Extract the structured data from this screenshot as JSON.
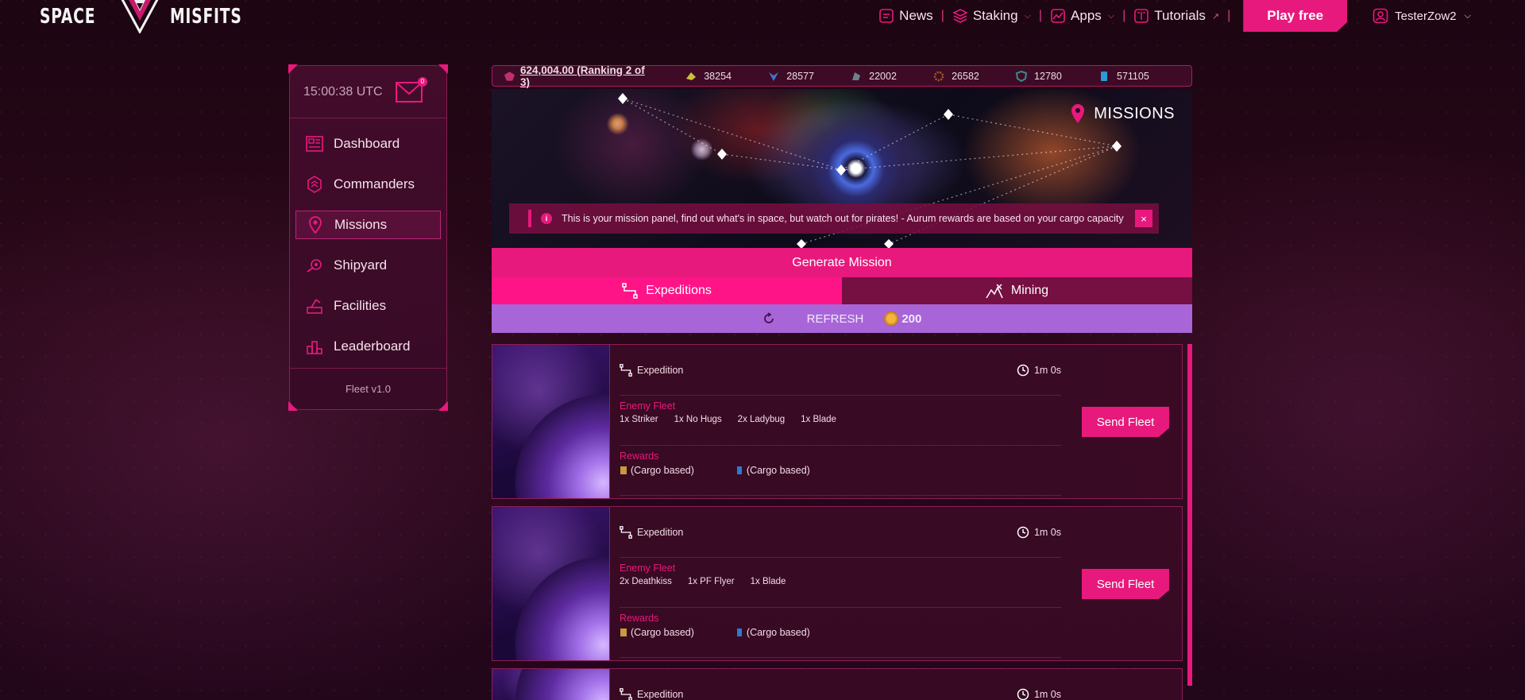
{
  "header": {
    "logo_left": "SPACE",
    "logo_right": "MISFITS",
    "nav": [
      {
        "label": "News",
        "icon": "news-icon",
        "has_dropdown": false
      },
      {
        "label": "Staking",
        "icon": "stack-icon",
        "has_dropdown": true
      },
      {
        "label": "Apps",
        "icon": "chart-icon",
        "has_dropdown": true
      },
      {
        "label": "Tutorials",
        "icon": "book-icon",
        "has_dropdown": false
      }
    ],
    "play_label": "Play free",
    "username": "TesterZow2"
  },
  "sidebar": {
    "clock": "15:00:38 UTC",
    "mail_count": "0",
    "items": [
      {
        "label": "Dashboard",
        "active": false
      },
      {
        "label": "Commanders",
        "active": false
      },
      {
        "label": "Missions",
        "active": true
      },
      {
        "label": "Shipyard",
        "active": false
      },
      {
        "label": "Facilities",
        "active": false
      },
      {
        "label": "Leaderboard",
        "active": false
      }
    ],
    "version": "Fleet v1.0"
  },
  "resources": {
    "main": "624,004.00 (Ranking 2 of 3)",
    "items": [
      "38254",
      "28577",
      "22002",
      "26582",
      "12780",
      "571105"
    ]
  },
  "banner": {
    "title": "MISSIONS",
    "info": "This is your mission panel, find out what's in space, but watch out for pirates! - Aurum rewards are based on your cargo capacity",
    "close_label": "×"
  },
  "controls": {
    "generate_label": "Generate Mission",
    "tab_expeditions": "Expeditions",
    "tab_mining": "Mining",
    "refresh_label": "REFRESH",
    "refresh_cost": "200"
  },
  "missions": [
    {
      "type": "Expedition",
      "time": "1m 0s",
      "enemy_title": "Enemy Fleet",
      "ships": [
        "1x Striker",
        "1x No Hugs",
        "2x Ladybug",
        "1x Blade"
      ],
      "rewards_title": "Rewards",
      "rewards": [
        "(Cargo based)",
        "(Cargo based)"
      ],
      "action": "Send Fleet"
    },
    {
      "type": "Expedition",
      "time": "1m 0s",
      "enemy_title": "Enemy Fleet",
      "ships": [
        "2x Deathkiss",
        "1x PF Flyer",
        "1x Blade"
      ],
      "rewards_title": "Rewards",
      "rewards": [
        "(Cargo based)",
        "(Cargo based)"
      ],
      "action": "Send Fleet"
    },
    {
      "type": "Expedition",
      "time": "1m 0s"
    }
  ],
  "colors": {
    "accent": "#e8197d",
    "refresh_bar": "#a865d8",
    "background": "#22061a"
  }
}
